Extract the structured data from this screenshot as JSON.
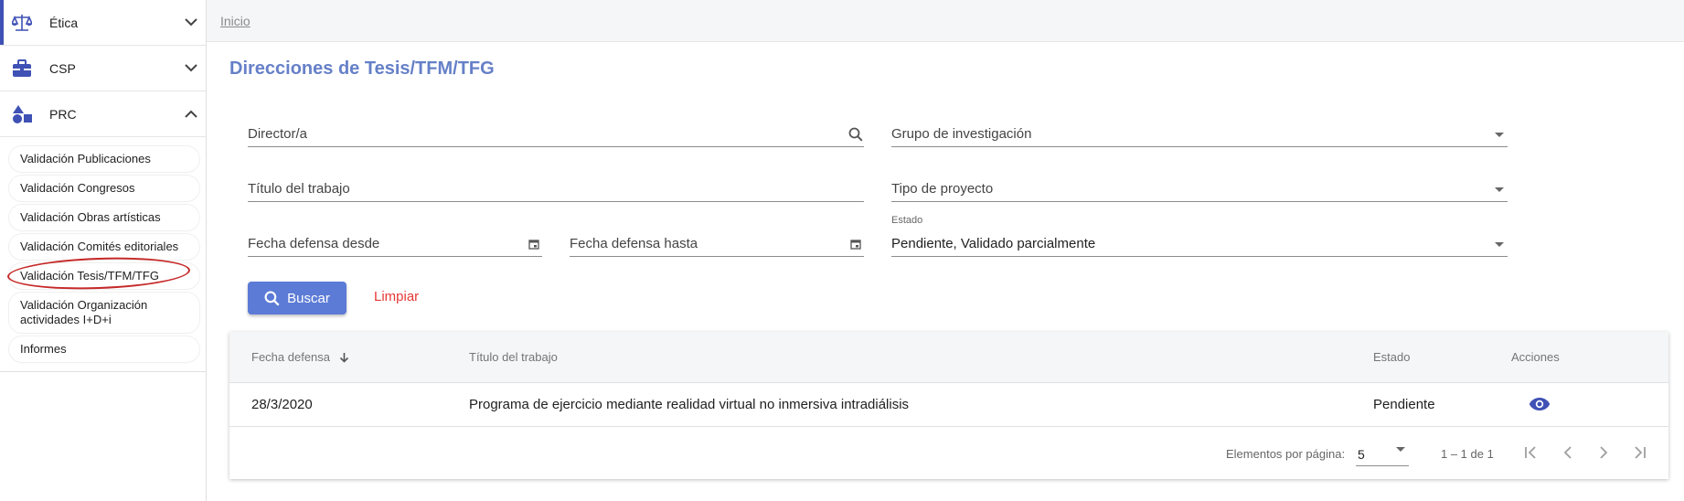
{
  "sidebar": {
    "modules": [
      {
        "label": "Ética",
        "icon": "scale-icon",
        "expanded": false
      },
      {
        "label": "CSP",
        "icon": "briefcase-icon",
        "expanded": false
      },
      {
        "label": "PRC",
        "icon": "shapes-icon",
        "expanded": true
      }
    ],
    "prc_items": [
      "Validación Publicaciones",
      "Validación Congresos",
      "Validación Obras artísticas",
      "Validación Comités editoriales",
      "Validación Tesis/TFM/TFG",
      "Validación Organización actividades I+D+i",
      "Informes"
    ]
  },
  "breadcrumb": "Inicio",
  "page_title": "Direcciones de Tesis/TFM/TFG",
  "filters": {
    "director_label": "Director/a",
    "grupo_label": "Grupo de investigación",
    "titulo_label": "Título del trabajo",
    "tipo_label": "Tipo de proyecto",
    "fecha_desde_label": "Fecha defensa desde",
    "fecha_hasta_label": "Fecha defensa hasta",
    "estado_label": "Estado",
    "estado_value": "Pendiente, Validado parcialmente"
  },
  "buttons": {
    "buscar": "Buscar",
    "limpiar": "Limpiar"
  },
  "table": {
    "headers": {
      "fecha": "Fecha defensa",
      "titulo": "Título del trabajo",
      "estado": "Estado",
      "acciones": "Acciones"
    },
    "rows": [
      {
        "fecha": "28/3/2020",
        "titulo": "Programa de ejercicio mediante realidad virtual no inmersiva intradiálisis",
        "estado": "Pendiente",
        "action_icon": "eye-icon"
      }
    ]
  },
  "paginator": {
    "label": "Elementos por página:",
    "page_size": "5",
    "range": "1 – 1 de 1"
  },
  "colors": {
    "accent": "#5c7bd6",
    "title": "#6680c8",
    "danger": "#e53935",
    "highlight_ring": "#c62828"
  }
}
